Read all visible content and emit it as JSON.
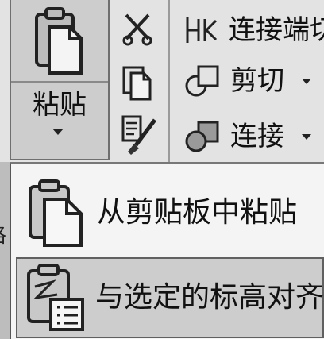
{
  "ribbon": {
    "paste_label": "粘贴",
    "commands": [
      {
        "id": "connect-ends",
        "label": "连接端切"
      },
      {
        "id": "cut",
        "label": "剪切"
      },
      {
        "id": "join",
        "label": "连接"
      }
    ]
  },
  "menu": {
    "items": [
      {
        "label": "从剪贴板中粘贴"
      },
      {
        "label": "与选定的标高对齐"
      }
    ]
  },
  "left_partial_text": "格"
}
